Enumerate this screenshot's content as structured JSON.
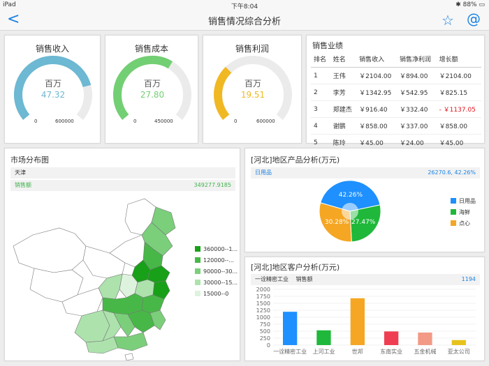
{
  "status": {
    "device": "iPad",
    "time": "下午8:04",
    "battery": "88%"
  },
  "nav": {
    "title": "销售情况综合分析"
  },
  "gauges": [
    {
      "title": "销售收入",
      "unit": "百万",
      "value": "47.32",
      "min": "0",
      "max": "600000",
      "fraction": 0.79,
      "color": "#6db8d2"
    },
    {
      "title": "销售成本",
      "unit": "百万",
      "value": "27.80",
      "min": "0",
      "max": "450000",
      "fraction": 0.62,
      "color": "#73cf73"
    },
    {
      "title": "销售利润",
      "unit": "百万",
      "value": "19.51",
      "min": "0",
      "max": "600000",
      "fraction": 0.33,
      "color": "#f0b823"
    }
  ],
  "sales_table": {
    "title": "销售业绩",
    "headers": [
      "排名",
      "姓名",
      "销售收入",
      "销售净利润",
      "增长额"
    ],
    "rows": [
      [
        "1",
        "王伟",
        "￥2104.00",
        "￥894.00",
        "￥2104.00"
      ],
      [
        "2",
        "李芳",
        "￥1342.95",
        "￥542.95",
        "￥825.15"
      ],
      [
        "3",
        "郑建杰",
        "￥916.40",
        "￥332.40",
        "- ￥1137.05"
      ],
      [
        "4",
        "谢鹏",
        "￥858.00",
        "￥337.00",
        "￥858.00"
      ],
      [
        "5",
        "陈玲",
        "￥45.00",
        "￥24.00",
        "￥45.00"
      ]
    ]
  },
  "map": {
    "title": "市场分布图",
    "region": "天津",
    "metric_label": "销售额",
    "metric_value": "349277.9185",
    "legend": [
      {
        "label": "360000--1...",
        "color": "#18a018"
      },
      {
        "label": "120000--...",
        "color": "#47b847"
      },
      {
        "label": "90000--30...",
        "color": "#7bcf7b"
      },
      {
        "label": "30000--15...",
        "color": "#ade2ad"
      },
      {
        "label": "15000--0",
        "color": "#def3de"
      }
    ]
  },
  "chart_data": [
    {
      "type": "pie",
      "title": "[河北]地区产品分析(万元)",
      "selected_label": "日用品",
      "selected_value": "26270.6, 42.26%",
      "categories": [
        "日用品",
        "海鲜",
        "点心"
      ],
      "values": [
        42.26,
        27.47,
        30.28
      ],
      "labels": [
        "42.26%",
        "27.47%",
        "30.28%"
      ],
      "colors": [
        "#1e90ff",
        "#1fb83a",
        "#f5a623"
      ]
    },
    {
      "type": "bar",
      "title": "[河北]地区客户分析(万元)",
      "selected_label": "一诠精密工业",
      "metric_label": "销售额",
      "selected_value": "1194",
      "categories": [
        "一诠精密工业",
        "上河工业",
        "世邦",
        "东南实业",
        "五金机械",
        "亚太公司"
      ],
      "values": [
        1194,
        530,
        1680,
        490,
        450,
        180
      ],
      "colors": [
        "#1e90ff",
        "#1fb83a",
        "#f5a623",
        "#ef3e52",
        "#f29a86",
        "#e8c21c"
      ],
      "yticks": [
        "0",
        "250",
        "500",
        "750",
        "1000",
        "1250",
        "1500",
        "1750",
        "2000"
      ],
      "ylim": [
        0,
        2000
      ]
    }
  ]
}
